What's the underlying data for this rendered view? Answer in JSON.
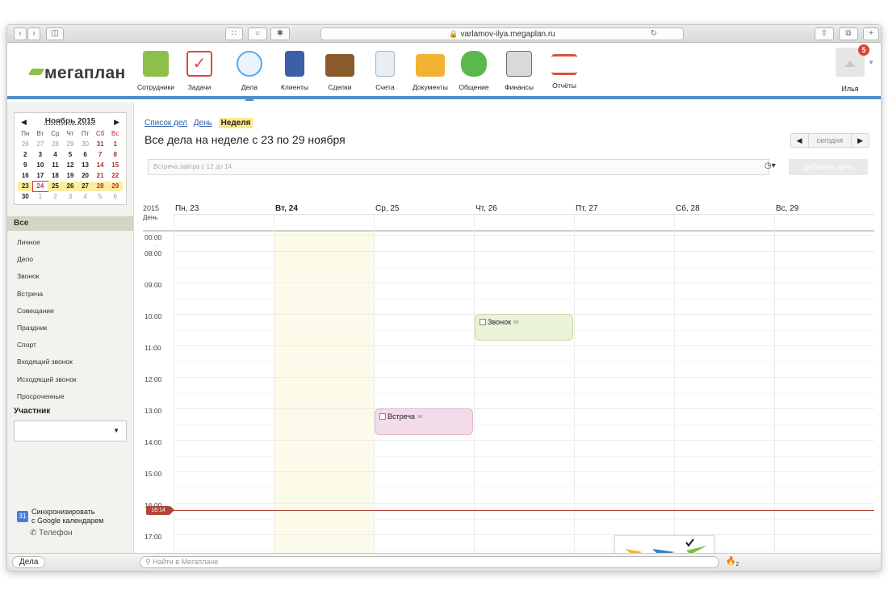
{
  "browser": {
    "url": "varlamov-ilya.megaplan.ru"
  },
  "app": {
    "logo": "мегаплан",
    "nav": [
      {
        "label": "Сотрудники",
        "icon": "employees-icon",
        "color": "#8dbf4a"
      },
      {
        "label": "Задачи",
        "icon": "tasks-icon",
        "color": "#d44a4a"
      },
      {
        "label": "Дела",
        "icon": "clock-icon",
        "color": "#5fa8e6"
      },
      {
        "label": "Клиенты",
        "icon": "clients-icon",
        "color": "#3c5fa8"
      },
      {
        "label": "Сделки",
        "icon": "deals-icon",
        "color": "#8a5a2c"
      },
      {
        "label": "Счета",
        "icon": "invoices-icon",
        "color": "#9fb7c8"
      },
      {
        "label": "Документы",
        "icon": "documents-icon",
        "color": "#f2b332"
      },
      {
        "label": "Общение",
        "icon": "chat-icon",
        "color": "#5cb84a"
      },
      {
        "label": "Финансы",
        "icon": "finance-icon",
        "color": "#6b6b6b"
      },
      {
        "label": "Отчёты",
        "icon": "reports-icon",
        "color": "#d9533a"
      }
    ],
    "user": {
      "name": "Илья",
      "notifications": "5"
    }
  },
  "minical": {
    "month": "Ноябрь 2015",
    "dow": [
      "Пн",
      "Вт",
      "Ср",
      "Чт",
      "Пт",
      "Сб",
      "Вс"
    ],
    "weeks": [
      [
        "26",
        "27",
        "28",
        "29",
        "30",
        "31",
        "1"
      ],
      [
        "2",
        "3",
        "4",
        "5",
        "6",
        "7",
        "8"
      ],
      [
        "9",
        "10",
        "11",
        "12",
        "13",
        "14",
        "15"
      ],
      [
        "16",
        "17",
        "18",
        "19",
        "20",
        "21",
        "22"
      ],
      [
        "23",
        "24",
        "25",
        "26",
        "27",
        "28",
        "29"
      ],
      [
        "30",
        "1",
        "2",
        "3",
        "4",
        "5",
        "6"
      ]
    ],
    "today": "24"
  },
  "filters": {
    "header": "Все",
    "items": [
      "Личное",
      "Дело",
      "Звонок",
      "Встреча",
      "Совещание",
      "Праздник",
      "Спорт",
      "Входящий звонок",
      "Исходящий звонок",
      "Просроченные"
    ],
    "member_label": "Участник",
    "gsync": [
      "Синхронизировать",
      "с Google календарем"
    ],
    "gsync_badge": "31",
    "phone": "Телефон"
  },
  "main": {
    "views": {
      "list": "Список дел",
      "day": "День",
      "week": "Неделя"
    },
    "title": "Все дела  на неделе с 23 по 29 ноября",
    "period_today": "сегодня",
    "quick_placeholder": "Встреча завтра с 12 до 14",
    "add_label": "Добавить дело"
  },
  "week": {
    "year": "2015",
    "allday": "День",
    "days": [
      "Пн, 23",
      "Вт, 24",
      "Ср, 25",
      "Чт, 26",
      "Пт, 27",
      "Сб, 28",
      "Вс, 29"
    ],
    "today_index": 1,
    "times": [
      "00:00",
      "08:00",
      "09:00",
      "10:00",
      "11:00",
      "12:00",
      "13:00",
      "14:00",
      "15:00",
      "16:00",
      "17:00"
    ],
    "now": "16:14",
    "events": [
      {
        "title": "Звонок",
        "day": 3,
        "start": "10:00",
        "end": "10:50",
        "color": "#eaf2d8"
      },
      {
        "title": "Встреча",
        "day": 2,
        "start": "13:00",
        "end": "13:50",
        "color": "#f3dcea"
      }
    ]
  },
  "bottom": {
    "tab": "Дела",
    "search_placeholder": "Найти в Мегаплане",
    "fire_count": "2"
  }
}
